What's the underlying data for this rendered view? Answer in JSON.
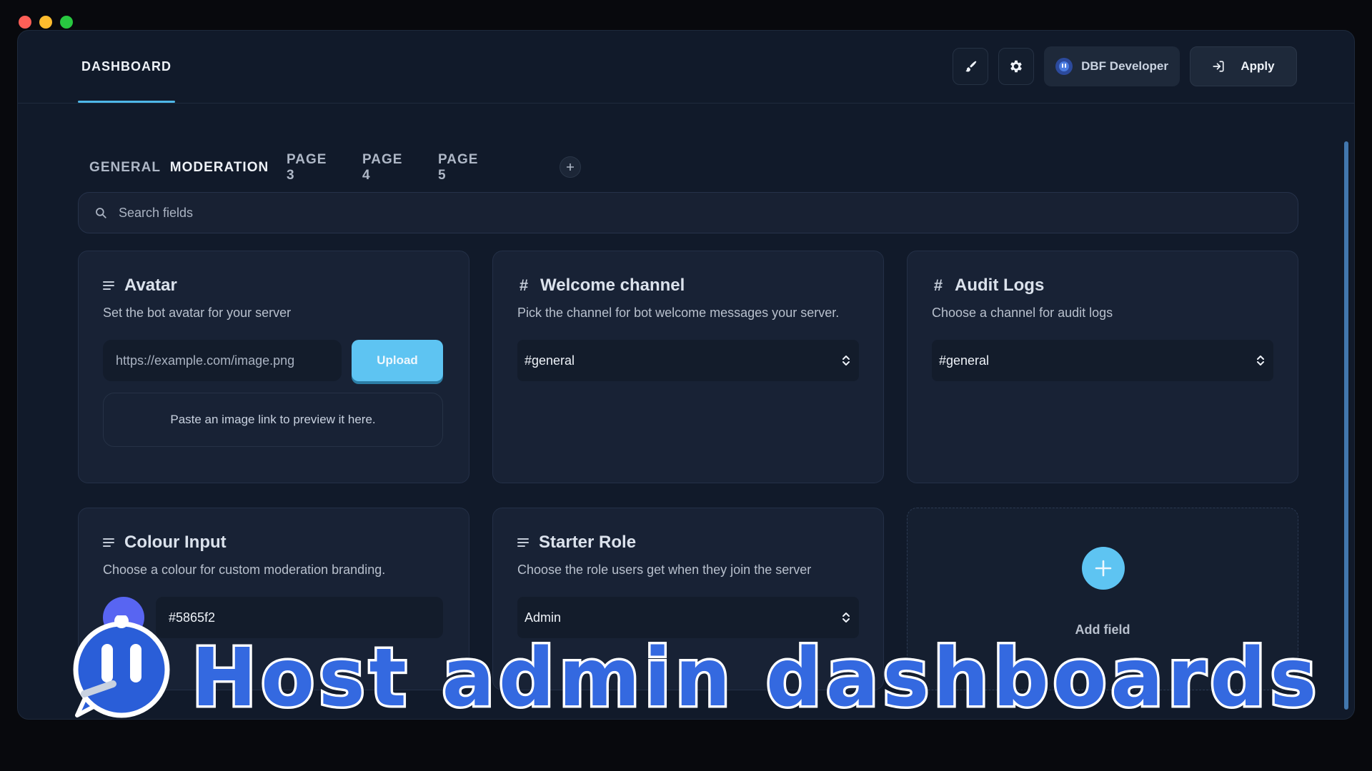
{
  "header": {
    "title": "DASHBOARD",
    "user_label": "DBF Developer",
    "apply_label": "Apply"
  },
  "tabs": [
    {
      "label": "GENERAL",
      "active": false
    },
    {
      "label": "MODERATION",
      "active": true
    },
    {
      "label": "PAGE 3",
      "active": false
    },
    {
      "label": "PAGE 4",
      "active": false
    },
    {
      "label": "PAGE 5",
      "active": false
    }
  ],
  "search": {
    "placeholder": "Search fields"
  },
  "cards": {
    "avatar": {
      "title": "Avatar",
      "description": "Set the bot avatar for your server",
      "url_placeholder": "https://example.com/image.png",
      "upload_label": "Upload",
      "preview_text": "Paste an image link to preview it here."
    },
    "welcome": {
      "title": "Welcome channel",
      "description": "Pick the channel for bot welcome messages your server.",
      "selected": "#general"
    },
    "audit": {
      "title": "Audit Logs",
      "description": "Choose a channel for audit logs",
      "selected": "#general"
    },
    "colour": {
      "title": "Colour Input",
      "description": "Choose a colour for custom moderation branding.",
      "value": "#5865f2"
    },
    "starter": {
      "title": "Starter Role",
      "description": "Choose the role users get when they join the server",
      "selected": "Admin"
    },
    "add": {
      "label": "Add field"
    }
  },
  "banner": {
    "text": "Host admin dashboards"
  },
  "colors": {
    "accent": "#4fb8e8",
    "upload_button": "#5ec4f2",
    "swatch": "#5865f2",
    "window_bg": "#111a2a",
    "card_bg": "#182235"
  },
  "icons": {
    "brush": "brush-icon",
    "settings": "gear-icon",
    "login": "login-icon",
    "search": "search-icon",
    "text_field": "text-lines-icon",
    "channel": "hash-icon",
    "select": "chevron-up-down-icon",
    "add": "plus-icon"
  }
}
